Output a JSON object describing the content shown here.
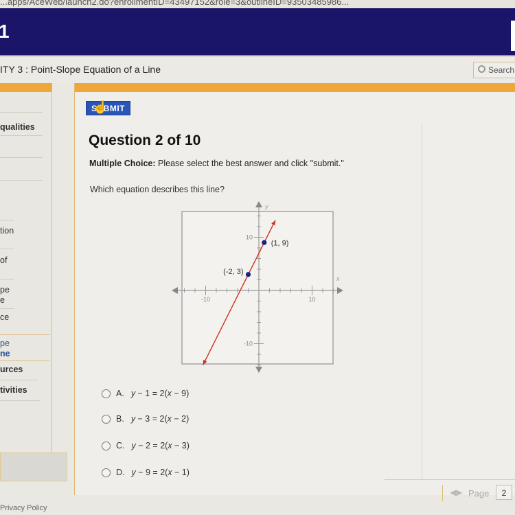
{
  "browser": {
    "url_fragment": "...apps/AceWeb/launch2.do?enrollmentID=43497152&role=3&outlineID=93503485986..."
  },
  "header": {
    "logo_text": "1"
  },
  "page": {
    "title": "ITY 3 : Point-Slope Equation of a Line"
  },
  "search": {
    "label": "Search",
    "icon": "search-icon"
  },
  "sidebar": {
    "items": [
      {
        "label": "qualities",
        "style": "dark"
      },
      {
        "label": "tion",
        "style": "dark"
      },
      {
        "label": "of",
        "style": "dark"
      },
      {
        "label": "pe",
        "style": "dark"
      },
      {
        "label": "e",
        "style": "dark"
      },
      {
        "label": "ce",
        "style": "dark"
      },
      {
        "label": "pe",
        "style": "blue"
      },
      {
        "label": "ne",
        "style": "blue"
      },
      {
        "label": "urces",
        "style": "dark"
      },
      {
        "label": "tivities",
        "style": "dark"
      }
    ],
    "privacy_label": "Privacy Policy"
  },
  "question": {
    "submit_label": "SUBMIT",
    "title": "Question 2 of 10",
    "instruction_bold": "Multiple Choice:",
    "instruction_text": " Please select the best answer and click \"submit.\"",
    "prompt": "Which equation describes this line?"
  },
  "chart_data": {
    "type": "line",
    "xlabel": "x",
    "ylabel": "y",
    "xlim": [
      -15,
      15
    ],
    "ylim": [
      -15,
      15
    ],
    "tick_step": 2,
    "tick_labels_x": [
      "-10",
      "10"
    ],
    "tick_labels_y": [
      "10",
      "-10"
    ],
    "line": {
      "slope": 2,
      "intercept": 7,
      "color": "#cc3322"
    },
    "points": [
      {
        "x": -2,
        "y": 3,
        "label": "(-2, 3)"
      },
      {
        "x": 1,
        "y": 9,
        "label": "(1, 9)"
      }
    ],
    "point_color": "#1a237e"
  },
  "options": [
    {
      "letter": "A.",
      "lhs": "y",
      "lhs_rest": " − 1 = 2(",
      "x": "x",
      "rhs_rest": " − 9)"
    },
    {
      "letter": "B.",
      "lhs": "y",
      "lhs_rest": " − 3 = 2(",
      "x": "x",
      "rhs_rest": " − 2)"
    },
    {
      "letter": "C.",
      "lhs": "y",
      "lhs_rest": " − 2 = 2(",
      "x": "x",
      "rhs_rest": " − 3)"
    },
    {
      "letter": "D.",
      "lhs": "y",
      "lhs_rest": " − 9 = 2(",
      "x": "x",
      "rhs_rest": " − 1)"
    }
  ],
  "pager": {
    "label": "Page",
    "value": "2"
  }
}
